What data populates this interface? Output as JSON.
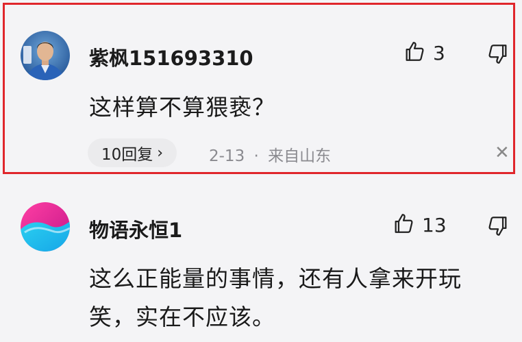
{
  "comments": [
    {
      "username": "紫枫151693310",
      "text_lines": [
        "这样算不算猥亵？"
      ],
      "like_count": "3",
      "replies_label": "10回复",
      "date": "2-13",
      "separator": "·",
      "location": "来自山东",
      "highlighted": true,
      "avatar": "person-photo"
    },
    {
      "username": "物语永恒1",
      "text_lines": [
        "这么正能量的事情，还有人拿来开玩",
        "笑，实在不应该。"
      ],
      "like_count": "13",
      "avatar": "gradient-blob"
    }
  ],
  "icons": {
    "like": "thumbs-up-icon",
    "dislike": "thumbs-down-icon",
    "reply_arrow": "chevron-right-icon",
    "close": "close-icon"
  },
  "colors": {
    "highlight_border": "#e0262b",
    "meta_text": "#8a8a8f",
    "background": "#f4f4f6"
  }
}
